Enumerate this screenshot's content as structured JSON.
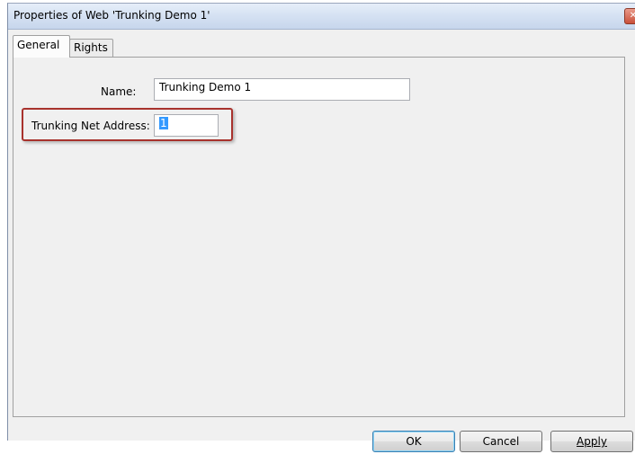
{
  "window": {
    "title": "Properties of Web 'Trunking Demo 1'"
  },
  "tabs": [
    {
      "label": "General",
      "active": true
    },
    {
      "label": "Rights",
      "active": false
    }
  ],
  "form": {
    "name_label": "Name:",
    "name_value": "Trunking Demo 1",
    "address_label": "Trunking Net Address:",
    "address_value": "1"
  },
  "buttons": {
    "ok": "OK",
    "cancel": "Cancel",
    "apply": "Apply"
  },
  "colors": {
    "highlight_border": "#a8322d",
    "selection": "#3399ff"
  },
  "icons": {
    "close": "close-icon"
  }
}
